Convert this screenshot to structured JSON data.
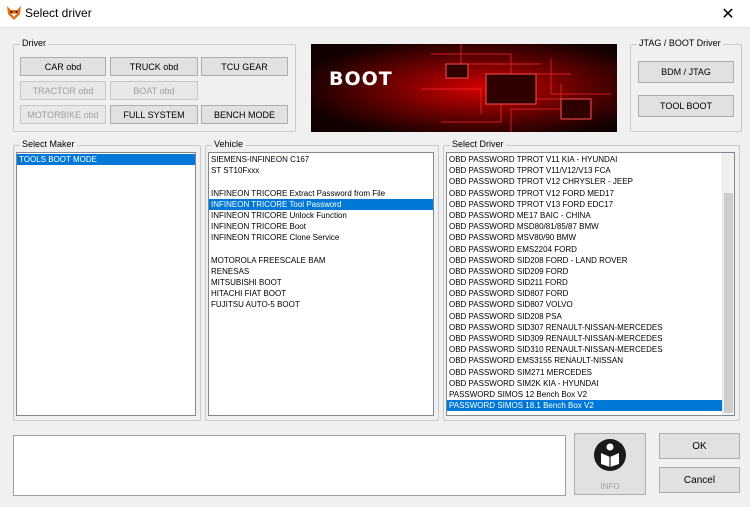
{
  "window": {
    "title": "Select driver",
    "close_glyph": "✕"
  },
  "driver_group": {
    "label": "Driver",
    "buttons": [
      {
        "label": "CAR  obd",
        "enabled": true
      },
      {
        "label": "TRUCK  obd",
        "enabled": true
      },
      {
        "label": "TCU GEAR",
        "enabled": true
      },
      {
        "label": "TRACTOR  obd",
        "enabled": false
      },
      {
        "label": "BOAT  obd",
        "enabled": false
      },
      {
        "label": "MOTORBIKE  obd",
        "enabled": false
      },
      {
        "label": "FULL SYSTEM",
        "enabled": true
      },
      {
        "label": "BENCH MODE",
        "enabled": true
      }
    ]
  },
  "banner": {
    "text": "BOOT"
  },
  "jtag_group": {
    "label": "JTAG / BOOT Driver",
    "buttons": [
      "BDM / JTAG",
      "TOOL BOOT"
    ]
  },
  "maker": {
    "label": "Select Maker",
    "items": [
      "TOOLS BOOT MODE"
    ],
    "selected_index": 0
  },
  "vehicle": {
    "label": "Vehicle",
    "items": [
      "SIEMENS-INFINEON C167",
      "ST ST10Fxxx",
      "",
      "INFINEON TRICORE Extract Password from File",
      "INFINEON TRICORE Tool Password",
      "INFINEON TRICORE Unlock Function",
      "INFINEON TRICORE Boot",
      "INFINEON TRICORE Clone Service",
      "",
      "MOTOROLA FREESCALE BAM",
      "RENESAS",
      "MITSUBISHI BOOT",
      "HITACHI FIAT BOOT",
      "FUJITSU AUTO-5 BOOT"
    ],
    "selected_index": 4
  },
  "driver_list": {
    "label": "Select Driver",
    "items": [
      "OBD PASSWORD TPROT V11 KIA - HYUNDAI",
      "OBD PASSWORD TPROT V11/V12/V13 FCA",
      "OBD PASSWORD TPROT V12 CHRYSLER - JEEP",
      "OBD PASSWORD TPROT V12 FORD MED17",
      "OBD PASSWORD TPROT V13 FORD EDC17",
      "OBD PASSWORD ME17 BAIC - CHINA",
      "OBD PASSWORD MSD80/81/85/87 BMW",
      "OBD PASSWORD MSV80/90 BMW",
      "OBD PASSWORD EMS2204 FORD",
      "OBD PASSWORD SID208 FORD - LAND ROVER",
      "OBD PASSWORD SID209 FORD",
      "OBD PASSWORD SID211 FORD",
      "OBD PASSWORD SID807 FORD",
      "OBD PASSWORD SID807 VOLVO",
      "OBD PASSWORD SID208 PSA",
      "OBD PASSWORD SID307 RENAULT-NISSAN-MERCEDES",
      "OBD PASSWORD SID309 RENAULT-NISSAN-MERCEDES",
      "OBD PASSWORD SID310 RENAULT-NISSAN-MERCEDES",
      "OBD PASSWORD EMS3155 RENAULT-NISSAN",
      "OBD PASSWORD SIM271 MERCEDES",
      "OBD PASSWORD SIM2K KIA - HYUNDAI",
      "PASSWORD SIMOS 12 Bench Box V2",
      "PASSWORD SIMOS 18.1 Bench Box V2"
    ],
    "selected_index": 22
  },
  "info": {
    "label": "INFO"
  },
  "actions": {
    "ok": "OK",
    "cancel": "Cancel"
  },
  "colors": {
    "selection": "#0078d7",
    "banner_red": "#c40000"
  }
}
